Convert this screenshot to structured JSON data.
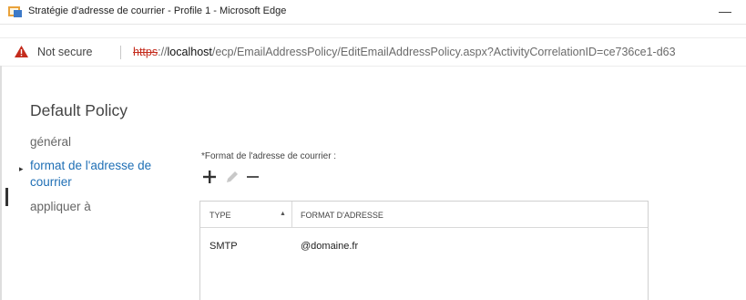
{
  "window": {
    "title": "Stratégie d'adresse de courrier - Profile 1 - Microsoft Edge",
    "minimize_glyph": "—"
  },
  "addressbar": {
    "security_label": "Not secure",
    "url_scheme": "https",
    "url_separator": "://",
    "url_host": "localhost",
    "url_path": "/ecp/EmailAddressPolicy/EditEmailAddressPolicy.aspx?ActivityCorrelationID=ce736ce1-d63"
  },
  "page": {
    "title": "Default Policy"
  },
  "nav": {
    "items": [
      {
        "label": "général",
        "active": false
      },
      {
        "label_line1": "format de l'adresse de",
        "label_line2": "courrier",
        "active": true
      },
      {
        "label": "appliquer à",
        "active": false
      }
    ],
    "active_marker": "▸"
  },
  "form": {
    "field_label": "*Format de l'adresse de courrier :",
    "toolbar": {
      "add_icon": "plus-icon",
      "edit_icon": "pencil-icon",
      "remove_icon": "minus-icon"
    }
  },
  "grid": {
    "columns": [
      "TYPE",
      "FORMAT D'ADRESSE"
    ],
    "sort_indicator": "▲",
    "rows": [
      {
        "type": "SMTP",
        "format": "@domaine.fr"
      }
    ]
  },
  "colors": {
    "link_active": "#1f6fb5",
    "warning": "#c42b1c"
  }
}
